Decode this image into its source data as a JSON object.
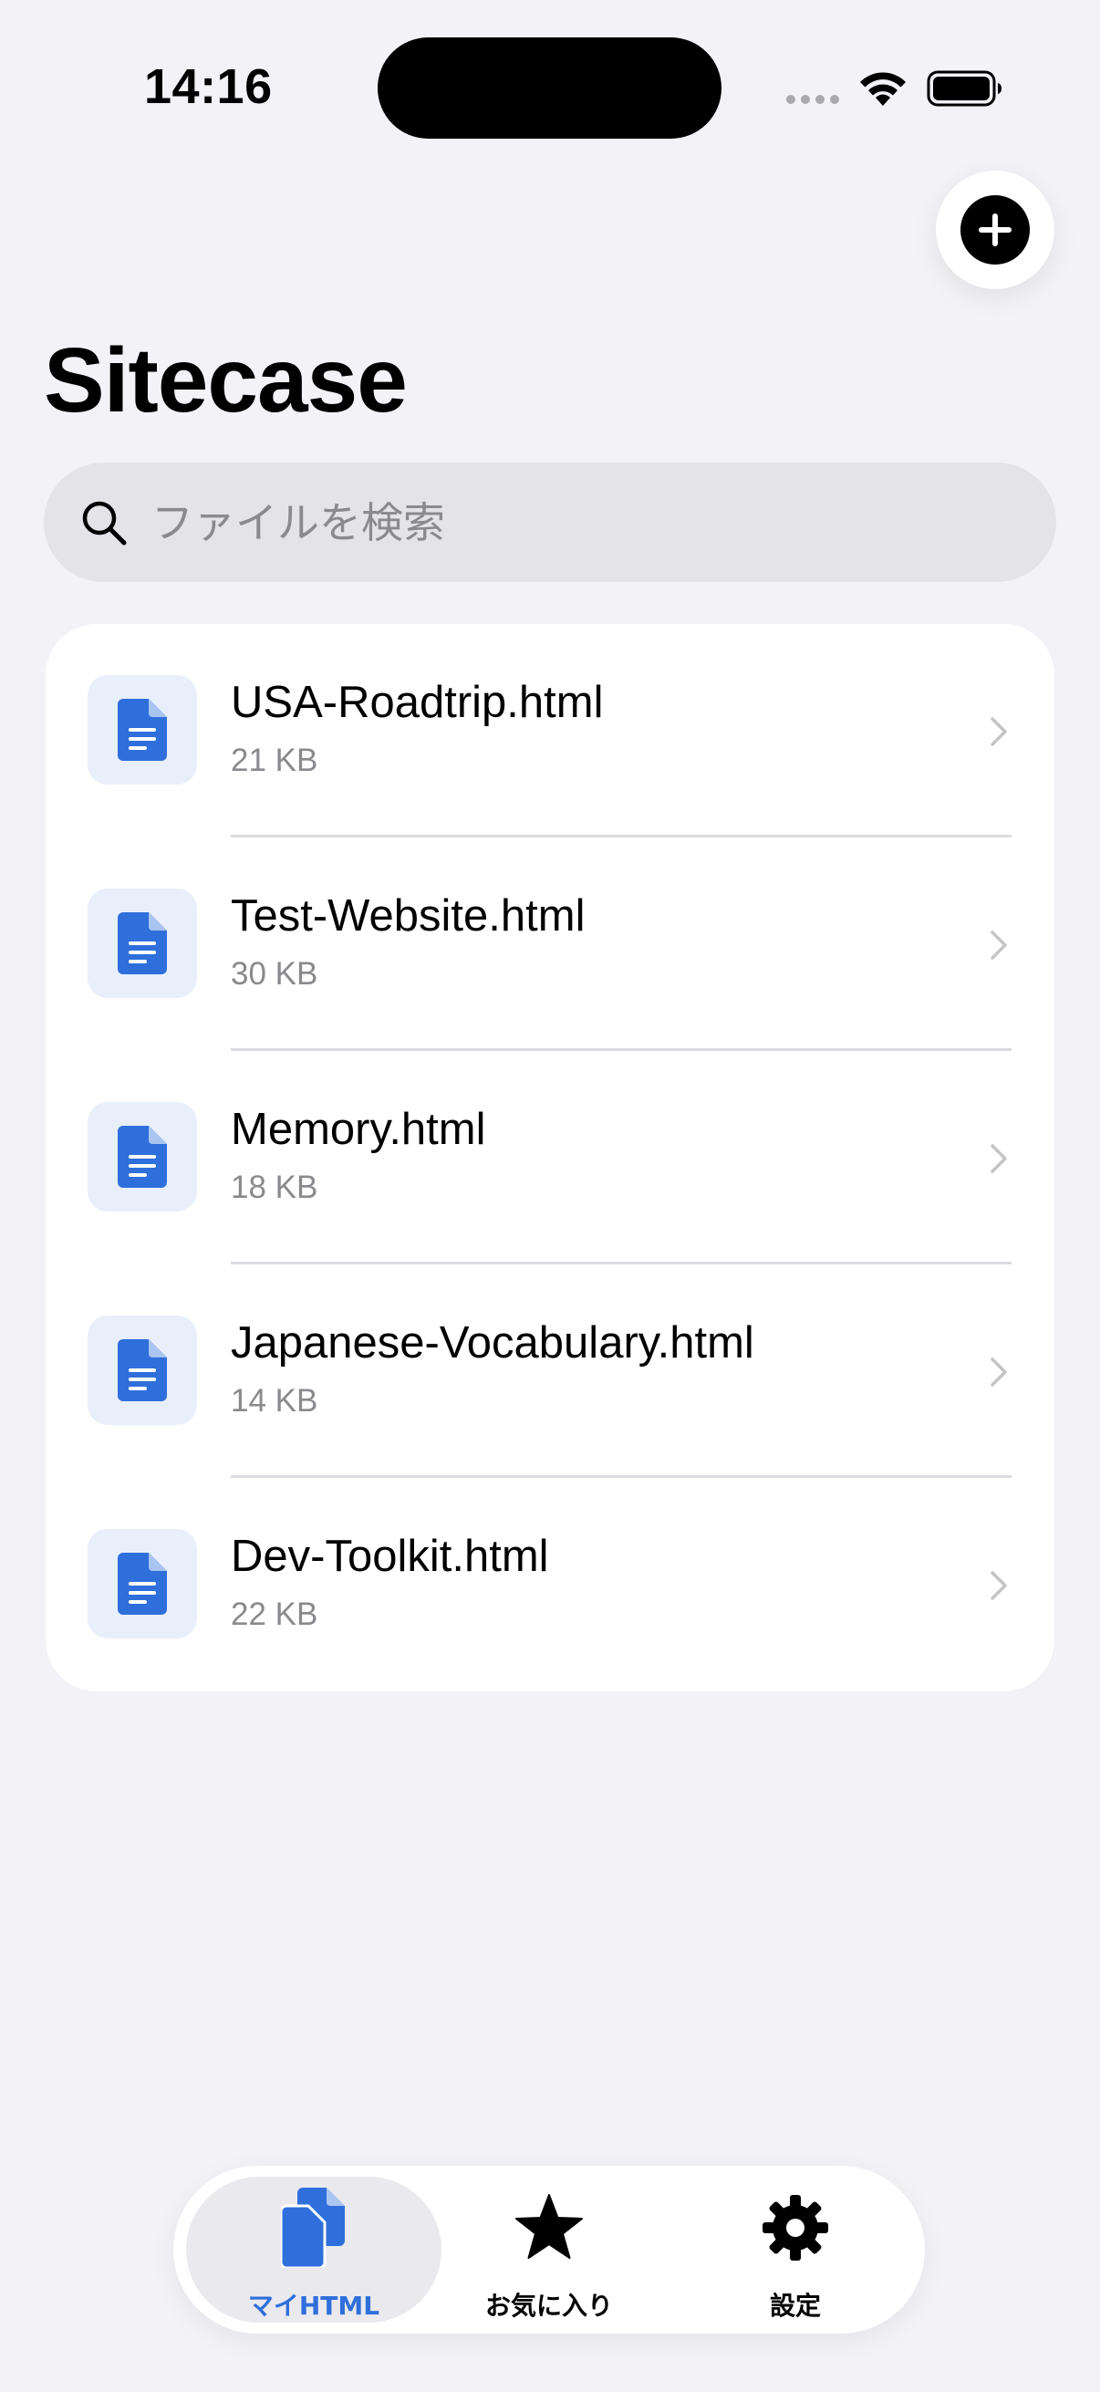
{
  "status_bar": {
    "time": "14:16"
  },
  "header": {
    "title": "Sitecase",
    "add_button_icon": "plus-circle-icon"
  },
  "search": {
    "placeholder": "ファイルを検索",
    "value": ""
  },
  "files": [
    {
      "name": "USA-Roadtrip.html",
      "size": "21 KB"
    },
    {
      "name": "Test-Website.html",
      "size": "30 KB"
    },
    {
      "name": "Memory.html",
      "size": "18 KB"
    },
    {
      "name": "Japanese-Vocabulary.html",
      "size": "14 KB"
    },
    {
      "name": "Dev-Toolkit.html",
      "size": "22 KB"
    }
  ],
  "tab_bar": {
    "tabs": [
      {
        "label": "マイHTML",
        "icon": "documents-icon",
        "active": true
      },
      {
        "label": "お気に入り",
        "icon": "star-icon",
        "active": false
      },
      {
        "label": "設定",
        "icon": "gear-icon",
        "active": false
      }
    ]
  },
  "colors": {
    "accent": "#2f6fdb",
    "background": "#f2f2f7",
    "card": "#ffffff",
    "secondary_text": "#8a8a8e"
  }
}
